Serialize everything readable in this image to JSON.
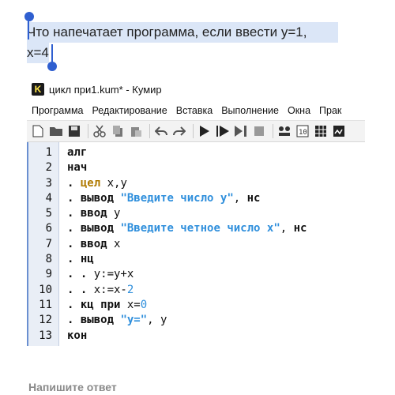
{
  "question": {
    "line1": "Что напечатает программа, если ввести y=1,",
    "line2": "x=4"
  },
  "app": {
    "icon_letter": "K",
    "title": "цикл при1.kum* - Кумир",
    "menu": [
      "Программа",
      "Редактирование",
      "Вставка",
      "Выполнение",
      "Окна",
      "Прак"
    ],
    "toolbar_icons": [
      "new-file-icon",
      "open-folder-icon",
      "save-icon",
      "cut-icon",
      "copy-icon",
      "paste-icon",
      "undo-icon",
      "redo-icon",
      "run-icon",
      "step-run-icon",
      "step-over-icon",
      "stop-icon",
      "variables-icon",
      "console-icon",
      "table-icon",
      "robot-icon"
    ]
  },
  "editor": {
    "line_numbers": [
      "1",
      "2",
      "3",
      "4",
      "5",
      "6",
      "7",
      "8",
      "9",
      "10",
      "11",
      "12",
      "13"
    ],
    "lines": [
      [
        {
          "t": "алг",
          "c": "kw"
        }
      ],
      [
        {
          "t": "нач",
          "c": "kw"
        }
      ],
      [
        {
          "t": ". ",
          "c": "dot"
        },
        {
          "t": "цел",
          "c": "ty"
        },
        {
          "t": " x,y",
          "c": ""
        }
      ],
      [
        {
          "t": ". ",
          "c": "dot"
        },
        {
          "t": "вывод",
          "c": "kw"
        },
        {
          "t": " ",
          "c": ""
        },
        {
          "t": "\"Введите число y\"",
          "c": "st"
        },
        {
          "t": ", ",
          "c": ""
        },
        {
          "t": "нс",
          "c": "kw"
        }
      ],
      [
        {
          "t": ". ",
          "c": "dot"
        },
        {
          "t": "ввод",
          "c": "kw"
        },
        {
          "t": " y",
          "c": ""
        }
      ],
      [
        {
          "t": ". ",
          "c": "dot"
        },
        {
          "t": "вывод",
          "c": "kw"
        },
        {
          "t": " ",
          "c": ""
        },
        {
          "t": "\"Введите четное число x\"",
          "c": "st"
        },
        {
          "t": ", ",
          "c": ""
        },
        {
          "t": "нс",
          "c": "kw"
        }
      ],
      [
        {
          "t": ". ",
          "c": "dot"
        },
        {
          "t": "ввод",
          "c": "kw"
        },
        {
          "t": " x",
          "c": ""
        }
      ],
      [
        {
          "t": ". ",
          "c": "dot"
        },
        {
          "t": "нц",
          "c": "kw"
        }
      ],
      [
        {
          "t": ". . ",
          "c": "dot"
        },
        {
          "t": "y:=y+x",
          "c": ""
        }
      ],
      [
        {
          "t": ". . ",
          "c": "dot"
        },
        {
          "t": "x:=x-",
          "c": ""
        },
        {
          "t": "2",
          "c": "nu"
        }
      ],
      [
        {
          "t": ". ",
          "c": "dot"
        },
        {
          "t": "кц",
          "c": "kw"
        },
        {
          "t": " ",
          "c": ""
        },
        {
          "t": "при",
          "c": "kw"
        },
        {
          "t": " x=",
          "c": ""
        },
        {
          "t": "0",
          "c": "nu"
        }
      ],
      [
        {
          "t": ". ",
          "c": "dot"
        },
        {
          "t": "вывод",
          "c": "kw"
        },
        {
          "t": " ",
          "c": ""
        },
        {
          "t": "\"y=\"",
          "c": "st"
        },
        {
          "t": ", y",
          "c": ""
        }
      ],
      [
        {
          "t": "кон",
          "c": "kw"
        }
      ]
    ]
  },
  "answer": {
    "label": "Напишите ответ"
  }
}
